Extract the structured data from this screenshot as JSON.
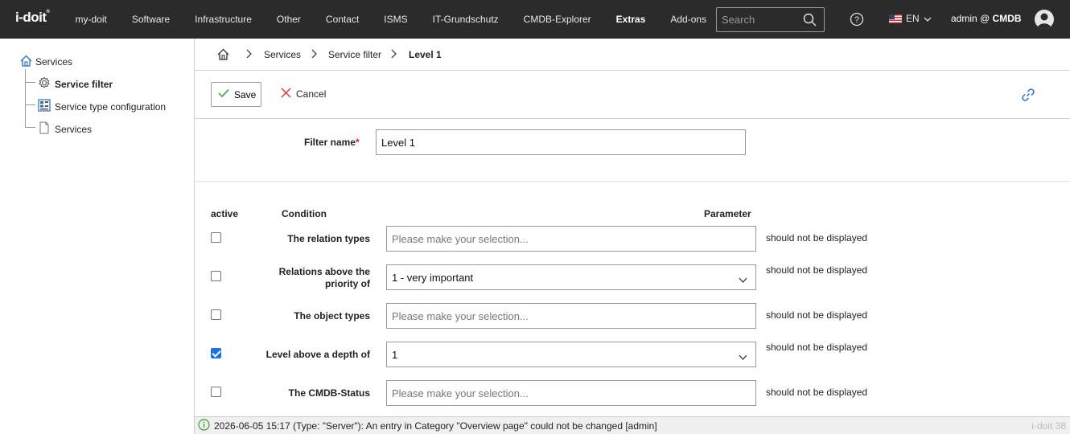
{
  "app": {
    "logo": "i-doit",
    "logo_mark": "®"
  },
  "nav": {
    "items": [
      "my-doit",
      "Software",
      "Infrastructure",
      "Other",
      "Contact",
      "ISMS",
      "IT-Grundschutz",
      "CMDB-Explorer",
      "Extras",
      "Add-ons"
    ],
    "active": "Extras"
  },
  "search": {
    "placeholder": "Search"
  },
  "lang": {
    "code": "EN"
  },
  "user": {
    "name": "admin @",
    "tenant": "CMDB"
  },
  "sidebar": {
    "root": "Services",
    "items": [
      {
        "label": "Service filter",
        "icon": "gear-icon",
        "active": true
      },
      {
        "label": "Service type configuration",
        "icon": "config-icon",
        "active": false
      },
      {
        "label": "Services",
        "icon": "document-icon",
        "active": false
      }
    ]
  },
  "breadcrumb": {
    "items": [
      "Services",
      "Service filter",
      "Level 1"
    ]
  },
  "toolbar": {
    "save_label": "Save",
    "cancel_label": "Cancel"
  },
  "form": {
    "filter_name_label": "Filter name",
    "required_mark": "*",
    "filter_name_value": "Level 1"
  },
  "table": {
    "headers": {
      "active": "active",
      "condition": "Condition",
      "parameter": "Parameter"
    },
    "rows": [
      {
        "label": "The relation types",
        "value": "Please make your selection...",
        "placeholder": true,
        "dropdown": false,
        "checked": false,
        "param": "should not be displayed"
      },
      {
        "label_line1": "Relations above the",
        "label_line2": "priority of",
        "value": "1 - very important",
        "placeholder": false,
        "dropdown": true,
        "checked": false,
        "param": "should not be displayed"
      },
      {
        "label": "The object types",
        "value": "Please make your selection...",
        "placeholder": true,
        "dropdown": false,
        "checked": false,
        "param": "should not be displayed"
      },
      {
        "label": "Level above a depth of",
        "value": "1",
        "placeholder": false,
        "dropdown": true,
        "checked": true,
        "param": "should not be displayed"
      },
      {
        "label": "The CMDB-Status",
        "value": "Please make your selection...",
        "placeholder": true,
        "dropdown": false,
        "checked": false,
        "param": "should not be displayed"
      }
    ]
  },
  "status": {
    "message": "2026-06-05 15:17 (Type: \"Server\"): An entry in Category \"Overview page\" could not be changed [admin]",
    "version": "i-doit 38"
  }
}
